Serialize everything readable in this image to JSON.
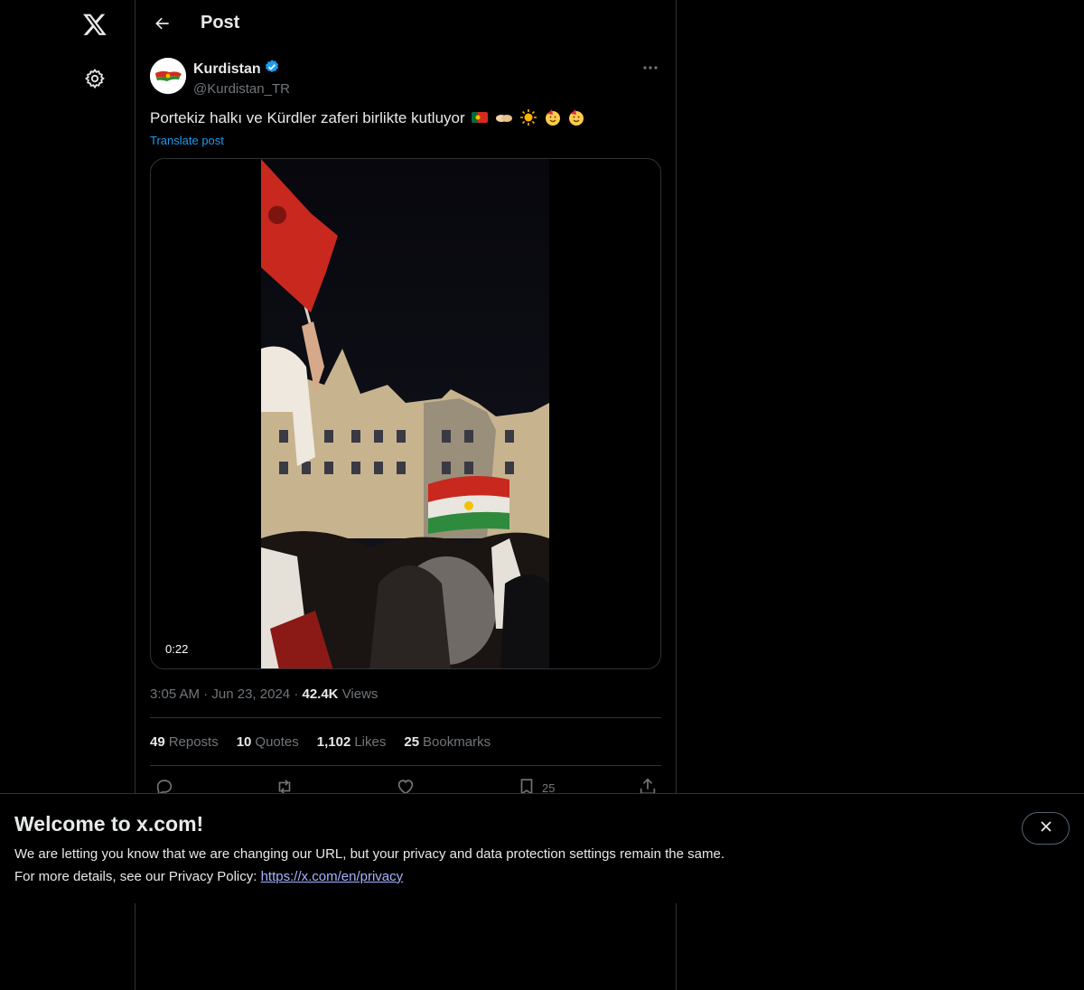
{
  "header": {
    "title": "Post"
  },
  "author": {
    "display_name": "Kurdistan",
    "handle": "@Kurdistan_TR",
    "verified": true
  },
  "post": {
    "text": "Portekiz halkı ve Kürdler zaferi birlikte kutluyor",
    "emojis": [
      "portugal-flag",
      "handshake",
      "sun",
      "partying-face",
      "partying-face"
    ],
    "translate_label": "Translate post",
    "video_duration": "0:22",
    "time": "3:05 AM",
    "date": "Jun 23, 2024",
    "views_count": "42.4K",
    "views_label": "Views"
  },
  "stats": {
    "reposts": {
      "count": "49",
      "label": "Reposts"
    },
    "quotes": {
      "count": "10",
      "label": "Quotes"
    },
    "likes": {
      "count": "1,102",
      "label": "Likes"
    },
    "bookmarks": {
      "count": "25",
      "label": "Bookmarks"
    }
  },
  "actions": {
    "reply": "",
    "repost": "",
    "like": "",
    "bookmark": "25",
    "share": ""
  },
  "banner": {
    "title": "Welcome to x.com!",
    "line1": "We are letting you know that we are changing our URL, but your privacy and data protection settings remain the same.",
    "line2_prefix": "For more details, see our Privacy Policy: ",
    "link_text": "https://x.com/en/privacy"
  },
  "colors": {
    "accent": "#1d9bf0",
    "link": "#a7b2ff",
    "border": "#2f3336",
    "muted": "#71767b"
  }
}
